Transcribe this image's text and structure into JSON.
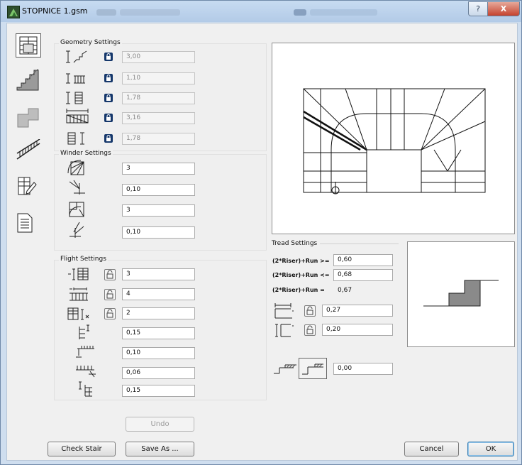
{
  "window": {
    "title": "STOPNICE 1.gsm"
  },
  "titlebar": {
    "help": "?",
    "close": "X"
  },
  "geometry": {
    "label": "Geometry Settings",
    "fields": [
      {
        "icon": "stair-height-icon",
        "value": "3,00"
      },
      {
        "icon": "stair-width-icon",
        "value": "1,10"
      },
      {
        "icon": "headroom-icon",
        "value": "1,78"
      },
      {
        "icon": "stair-length-icon",
        "value": "3,16"
      },
      {
        "icon": "landing-height-icon",
        "value": "1,78"
      }
    ]
  },
  "winder": {
    "label": "Winder Settings",
    "fields": [
      {
        "icon": "winder-steps-icon",
        "value": "3"
      },
      {
        "icon": "winder-offset-icon",
        "value": "0,10"
      },
      {
        "icon": "winder-steps-2-icon",
        "value": "3"
      },
      {
        "icon": "winder-offset-2-icon",
        "value": "0,10"
      }
    ]
  },
  "flight": {
    "label": "Flight Settings",
    "fields": [
      {
        "icon": "riser-count-icon",
        "value": "3",
        "lock": true
      },
      {
        "icon": "tread-count-icon",
        "value": "4",
        "lock": true
      },
      {
        "icon": "landing-steps-icon",
        "value": "2",
        "lock": true
      },
      {
        "icon": "riser-thickness-icon",
        "value": "0,15",
        "lock": false
      },
      {
        "icon": "nosing-icon",
        "value": "0,10",
        "lock": false
      },
      {
        "icon": "overhang-icon",
        "value": "0,06",
        "lock": false
      },
      {
        "icon": "stringer-icon",
        "value": "0,15",
        "lock": false
      }
    ]
  },
  "tread": {
    "label": "Tread Settings",
    "rule_ge_label": "(2*Riser)+Run >=",
    "rule_ge_value": "0,60",
    "rule_le_label": "(2*Riser)+Run <=",
    "rule_le_value": "0,68",
    "rule_eq_label": "(2*Riser)+Run =",
    "rule_eq_value": "0,67",
    "run_value": "0,27",
    "riser_value": "0,20",
    "offset_value": "0,00"
  },
  "buttons": {
    "undo": "Undo",
    "check_stair": "Check Stair",
    "save_as": "Save As ...",
    "cancel": "Cancel",
    "ok": "OK"
  },
  "sidebar": [
    "stair-plan-icon",
    "stair-section-icon",
    "stair-3d-icon",
    "railing-icon",
    "stair-edit-icon",
    "document-icon"
  ]
}
